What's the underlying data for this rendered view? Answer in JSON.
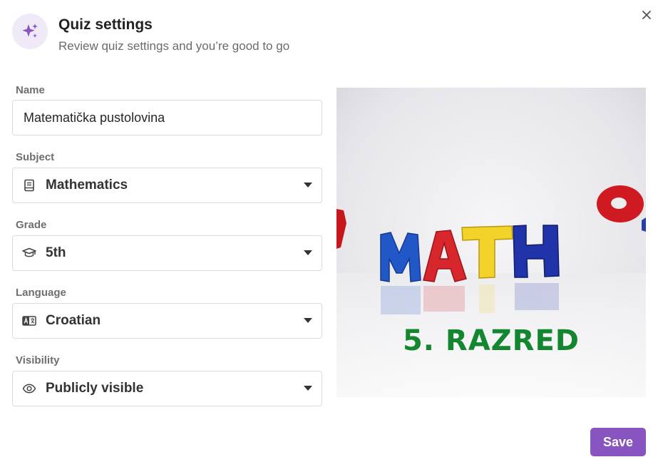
{
  "header": {
    "icon": "sparkles-icon",
    "title": "Quiz settings",
    "subtitle": "Review quiz settings and you’re good to go"
  },
  "close_icon": "close-icon",
  "form": {
    "name": {
      "label": "Name",
      "value": "Matematička pustolovina"
    },
    "subject": {
      "label": "Subject",
      "icon": "book-icon",
      "value": "Mathematics"
    },
    "grade": {
      "label": "Grade",
      "icon": "graduation-cap-icon",
      "value": "5th"
    },
    "language": {
      "label": "Language",
      "icon": "language-icon",
      "value": "Croatian"
    },
    "visibility": {
      "label": "Visibility",
      "icon": "eye-icon",
      "value": "Publicly visible"
    }
  },
  "cover_image": {
    "headline": "MATH",
    "caption": "5. RAZRED"
  },
  "save_label": "Save",
  "colors": {
    "accent": "#8854c0",
    "icon_bg": "#efe9f8"
  }
}
